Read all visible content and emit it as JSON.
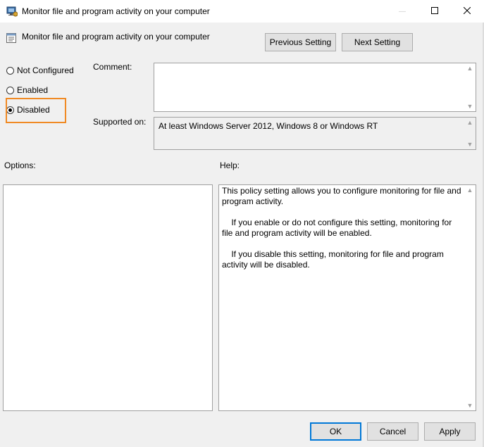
{
  "window": {
    "title": "Monitor file and program activity on your computer",
    "minimize_glyph": "—",
    "maximize_glyph": "☐",
    "close_glyph": "✕"
  },
  "header": {
    "policy_title": "Monitor file and program activity on your computer",
    "previous_label": "Previous Setting",
    "next_label": "Next Setting"
  },
  "state": {
    "options": [
      {
        "label": "Not Configured",
        "selected": false
      },
      {
        "label": "Enabled",
        "selected": false
      },
      {
        "label": "Disabled",
        "selected": true
      }
    ]
  },
  "fields": {
    "comment_label": "Comment:",
    "comment_value": "",
    "supported_label": "Supported on:",
    "supported_value": "At least Windows Server 2012, Windows 8 or Windows RT"
  },
  "sections": {
    "options_label": "Options:",
    "help_label": "Help:"
  },
  "help": {
    "paragraphs": [
      "This policy setting allows you to configure monitoring for file and program activity.",
      "    If you enable or do not configure this setting, monitoring for file and program activity will be enabled.",
      "    If you disable this setting, monitoring for file and program activity will be disabled."
    ]
  },
  "footer": {
    "ok_label": "OK",
    "cancel_label": "Cancel",
    "apply_label": "Apply"
  },
  "colors": {
    "highlight": "#f08a24",
    "ok_border": "#0078d7",
    "dialog_bg": "#f0f0f0"
  }
}
